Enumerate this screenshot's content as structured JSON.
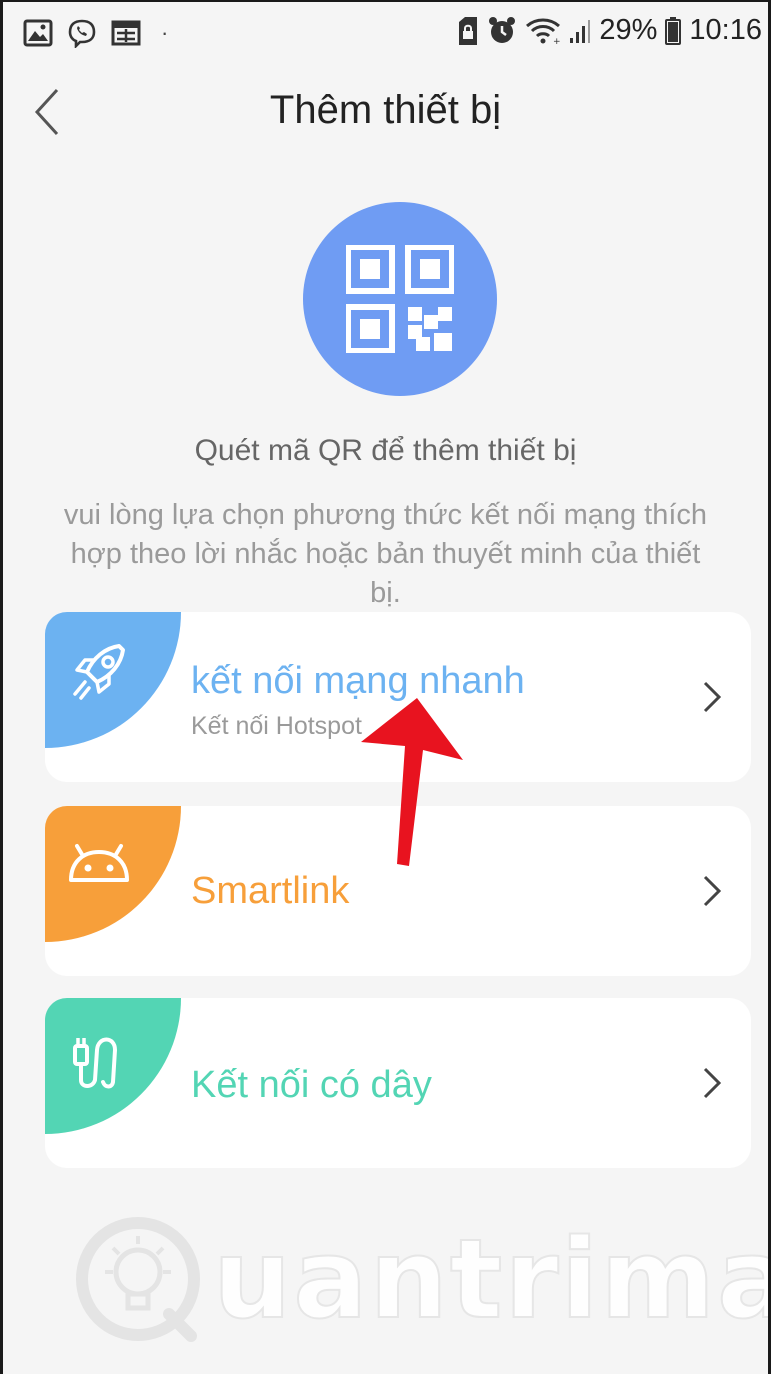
{
  "status_bar": {
    "battery": "29%",
    "time": "10:16",
    "dot": "·"
  },
  "header": {
    "title": "Thêm thiết bị"
  },
  "qr": {
    "label": "Quét mã QR để thêm thiết bị"
  },
  "hint": "vui lòng lựa chọn phương thức kết nối mạng thích hợp theo lời nhắc hoặc bản thuyết minh của thiết bị.",
  "options": [
    {
      "label": "kết nối mạng nhanh",
      "sublabel": "Kết nối Hotspot",
      "color": "#6cb2f1",
      "icon": "rocket-icon"
    },
    {
      "label": "Smartlink",
      "color": "#f79f3a",
      "icon": "android-icon"
    },
    {
      "label": "Kết nối có dây",
      "color": "#53d5b4",
      "icon": "cable-plug-icon"
    }
  ],
  "colors": {
    "qr_circle": "#6f9cf3",
    "annotation_arrow": "#e8131f"
  },
  "watermark": {
    "text": "uantrimang"
  }
}
